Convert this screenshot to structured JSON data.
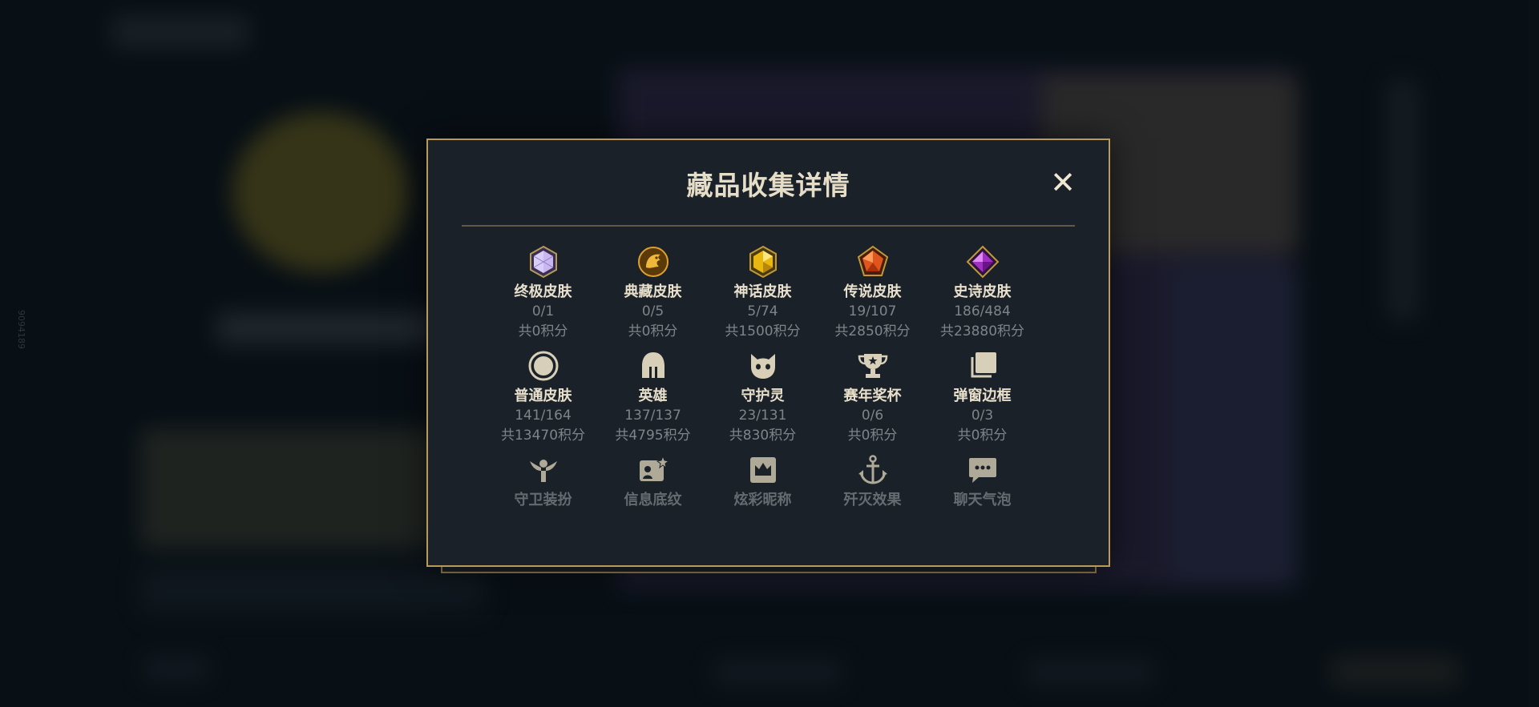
{
  "modal": {
    "title": "藏品收集详情",
    "close_label": "✕"
  },
  "side_id": "9094189",
  "items": [
    {
      "label": "终极皮肤",
      "count": "0/1",
      "points": "共0积分",
      "icon": "ultimate-skin-gem-icon",
      "color": "#c9b8f0"
    },
    {
      "label": "典藏皮肤",
      "count": "0/5",
      "points": "共0积分",
      "icon": "prestige-skin-dragon-icon",
      "color": "#d49a2a"
    },
    {
      "label": "神话皮肤",
      "count": "5/74",
      "points": "共1500积分",
      "icon": "mythic-skin-gem-icon",
      "color": "#e8b810"
    },
    {
      "label": "传说皮肤",
      "count": "19/107",
      "points": "共2850积分",
      "icon": "legendary-skin-gem-icon",
      "color": "#e0551e"
    },
    {
      "label": "史诗皮肤",
      "count": "186/484",
      "points": "共23880积分",
      "icon": "epic-skin-gem-icon",
      "color": "#a22fc4"
    },
    {
      "label": "普通皮肤",
      "count": "141/164",
      "points": "共13470积分",
      "icon": "normal-skin-circle-icon",
      "color": "#d8cfb8"
    },
    {
      "label": "英雄",
      "count": "137/137",
      "points": "共4795积分",
      "icon": "champion-helmet-icon",
      "color": "#d8cfb8"
    },
    {
      "label": "守护灵",
      "count": "23/131",
      "points": "共830积分",
      "icon": "guardian-pet-icon",
      "color": "#d8cfb8"
    },
    {
      "label": "赛年奖杯",
      "count": "0/6",
      "points": "共0积分",
      "icon": "trophy-icon",
      "color": "#d8cfb8"
    },
    {
      "label": "弹窗边框",
      "count": "0/3",
      "points": "共0积分",
      "icon": "popup-frame-icon",
      "color": "#d8cfb8"
    },
    {
      "label": "守卫装扮",
      "icon": "ward-skin-icon",
      "color": "#c9c1ab"
    },
    {
      "label": "信息底纹",
      "icon": "info-banner-icon",
      "color": "#c9c1ab"
    },
    {
      "label": "炫彩昵称",
      "icon": "crown-nickname-icon",
      "color": "#c9c1ab"
    },
    {
      "label": "歼灭效果",
      "icon": "anchor-finisher-icon",
      "color": "#c9c1ab"
    },
    {
      "label": "聊天气泡",
      "icon": "chat-bubble-icon",
      "color": "#c9c1ab"
    }
  ]
}
